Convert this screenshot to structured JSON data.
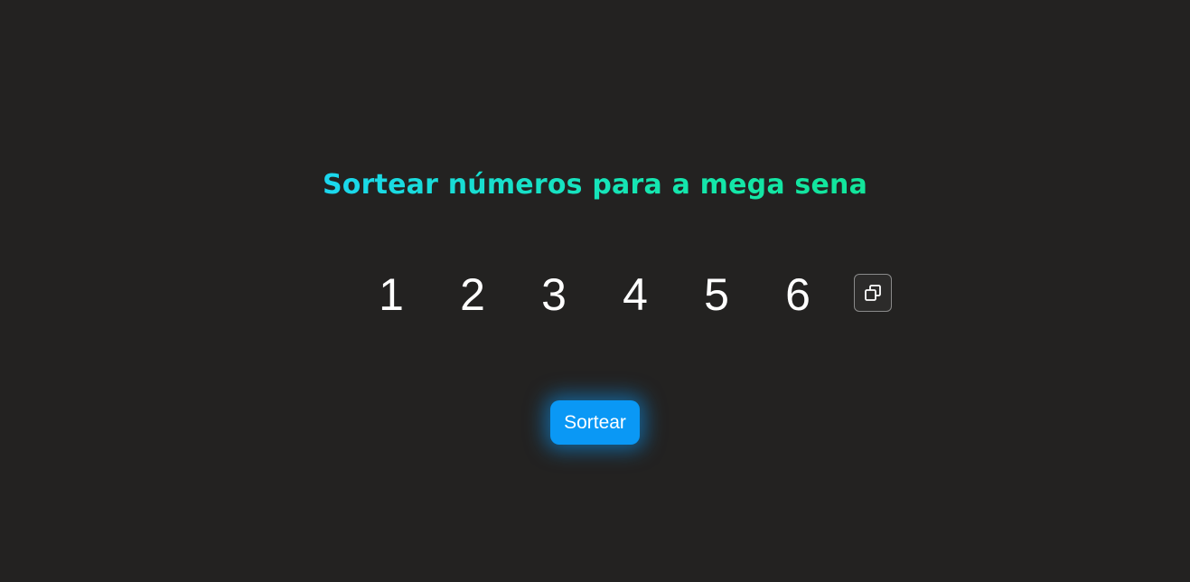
{
  "header": {
    "title": "Sortear números para a mega sena"
  },
  "numbers": [
    "1",
    "2",
    "3",
    "4",
    "5",
    "6"
  ],
  "actions": {
    "copy_icon": "copy-icon",
    "draw_label": "Sortear"
  },
  "colors": {
    "background": "#232221",
    "title_gradient_start": "#1bd7ef",
    "title_gradient_end": "#12e59a",
    "button": "#0a98f5"
  }
}
